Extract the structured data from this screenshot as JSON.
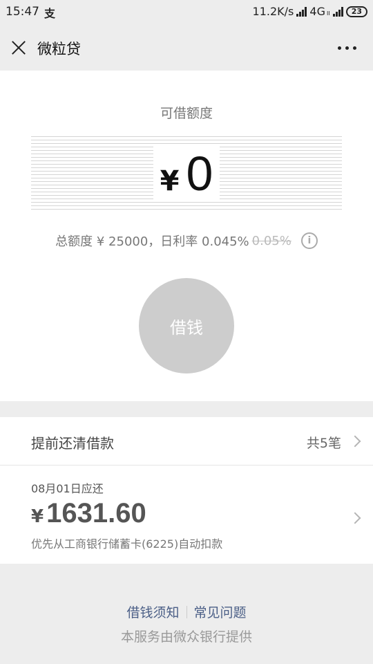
{
  "status_bar": {
    "time": "15:47",
    "app_icon_glyph": "支",
    "net_speed": "11.2K/s",
    "network": "4G",
    "network_sup": "II",
    "battery": "23"
  },
  "nav": {
    "title": "微粒贷"
  },
  "quota": {
    "label": "可借额度",
    "currency": "¥",
    "amount": "0",
    "total_text": "总额度 ¥ 25000，日利率 0.045%",
    "old_rate": "0.05%",
    "info_glyph": "i"
  },
  "borrow_button": {
    "label": "借钱"
  },
  "repay": {
    "title": "提前还清借款",
    "count": "共5笔",
    "due_date": "08月01日应还",
    "currency": "¥",
    "due_amount": "1631.60",
    "debit_note": "优先从工商银行储蓄卡(6225)自动扣款"
  },
  "footer": {
    "link_notice": "借钱须知",
    "link_faq": "常见问题",
    "provider": "本服务由微众银行提供"
  },
  "colors": {
    "link": "#4a5e86",
    "button_disabled": "#cdcdcd"
  }
}
